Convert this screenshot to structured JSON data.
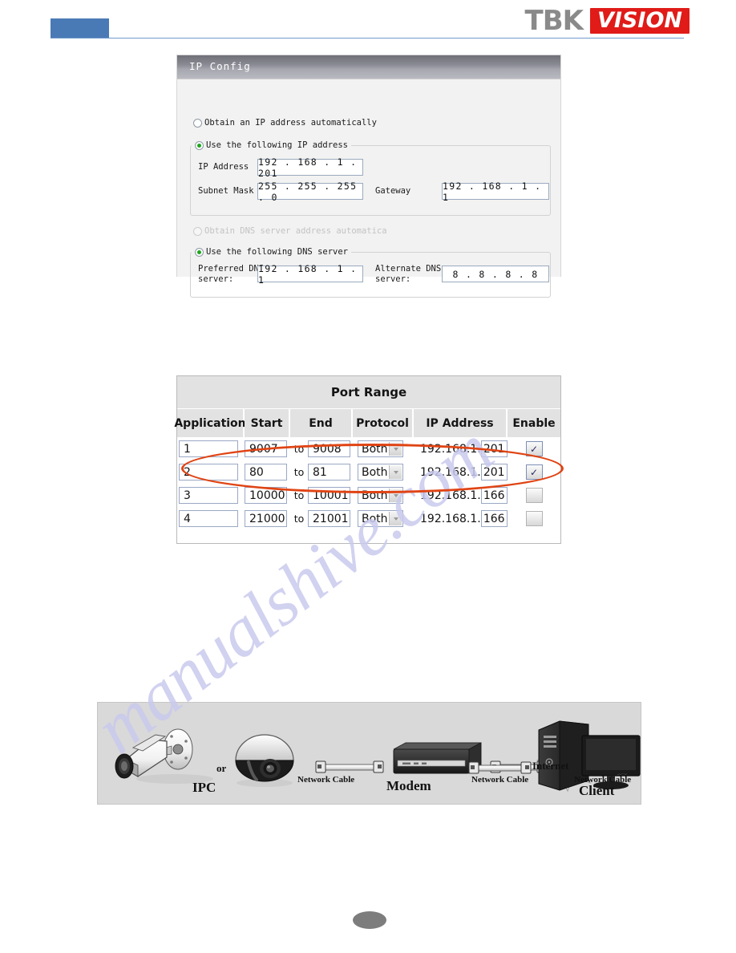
{
  "header": {
    "logo_tbk": "TBK",
    "logo_vision": "VISION",
    "accent_blue": "#4a7ab5",
    "accent_red": "#e01b18"
  },
  "watermark": {
    "text": "manualshive.com",
    "color": "#c9c9ee"
  },
  "ip_config": {
    "title": "IP Config",
    "radio_auto_ip": "Obtain an IP address automatically",
    "radio_manual_ip": "Use the following IP address",
    "label_ip_address": "IP Address",
    "value_ip_address": "192 . 168 .  1  . 201",
    "label_subnet_mask": "Subnet Mask",
    "value_subnet_mask": "255 . 255 . 255 .  0",
    "label_gateway": "Gateway",
    "value_gateway": "192 . 168 .  1  .  1",
    "radio_auto_dns": "Obtain DNS server address automatica",
    "radio_manual_dns": "Use the following DNS server",
    "label_preferred_dns": "Preferred DNS\nserver:",
    "value_preferred_dns": "192 . 168 .  1  .  1",
    "label_alternate_dns": "Alternate DNS\nserver:",
    "value_alternate_dns": "8  .  8  .  8  .  8"
  },
  "port_range": {
    "title": "Port Range",
    "columns": [
      "Application",
      "Start",
      "End",
      "Protocol",
      "IP Address",
      "Enable"
    ],
    "to_label": "to",
    "ip_prefix": "192.168.1.",
    "check_glyph": "✓",
    "highlight_color": "#e04414",
    "rows": [
      {
        "application": "1",
        "start": "9007",
        "end": "9008",
        "protocol": "Both",
        "ip_suffix": "201",
        "enabled": true
      },
      {
        "application": "2",
        "start": "80",
        "end": "81",
        "protocol": "Both",
        "ip_suffix": "201",
        "enabled": true
      },
      {
        "application": "3",
        "start": "10000",
        "end": "10001",
        "protocol": "Both",
        "ip_suffix": "166",
        "enabled": false
      },
      {
        "application": "4",
        "start": "21000",
        "end": "21001",
        "protocol": "Both",
        "ip_suffix": "166",
        "enabled": false
      }
    ]
  },
  "diagram": {
    "label_ipc": "IPC",
    "label_or": "or",
    "label_cable_1": "Network Cable",
    "label_modem": "Modem",
    "label_cable_2": "Network Cable",
    "label_internet": "Internet",
    "label_cable_3": "Network Cable",
    "label_client": "Client"
  }
}
